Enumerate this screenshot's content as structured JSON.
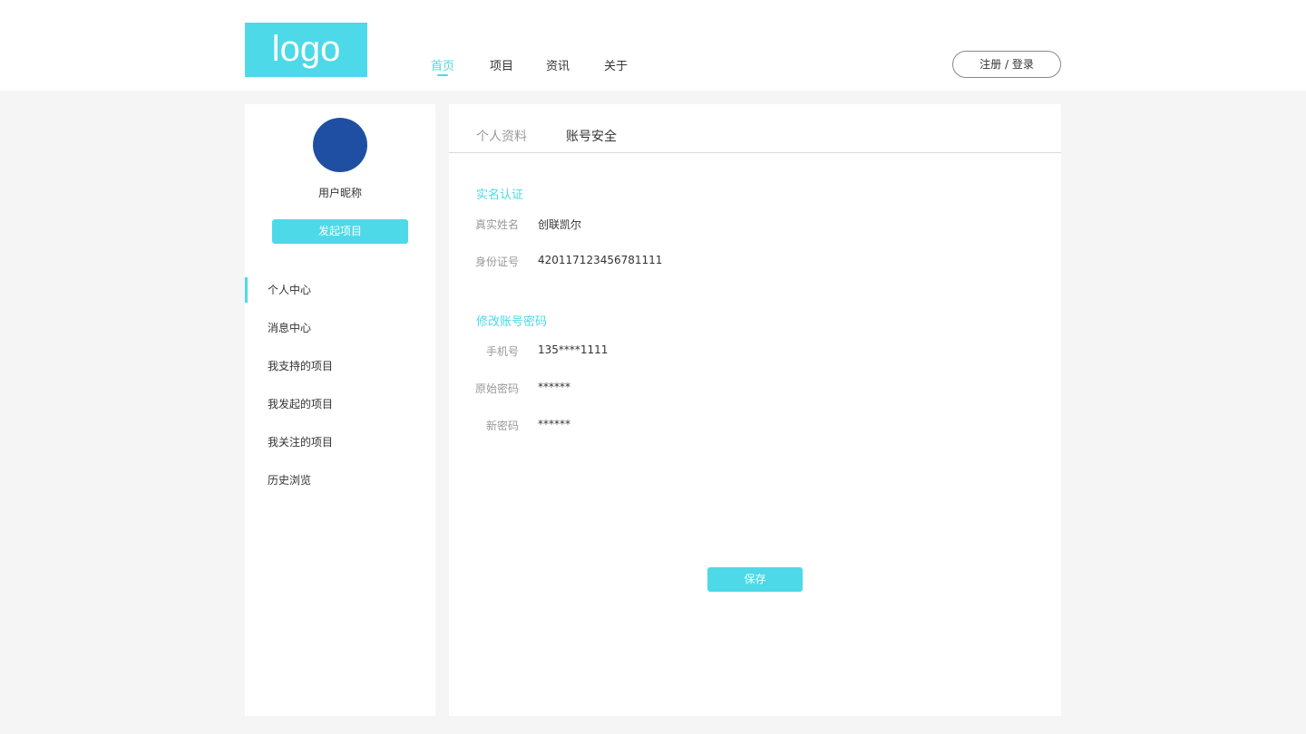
{
  "header": {
    "logo_text": "logo",
    "nav": [
      {
        "label": "首页",
        "active": true
      },
      {
        "label": "项目",
        "active": false
      },
      {
        "label": "资讯",
        "active": false
      },
      {
        "label": "关于",
        "active": false
      }
    ],
    "auth_label": "注册 / 登录"
  },
  "sidebar": {
    "nickname": "用户昵称",
    "launch_label": "发起项目",
    "menu": [
      {
        "label": "个人中心",
        "active": true
      },
      {
        "label": "消息中心",
        "active": false
      },
      {
        "label": "我支持的项目",
        "active": false
      },
      {
        "label": "我发起的项目",
        "active": false
      },
      {
        "label": "我关注的项目",
        "active": false
      },
      {
        "label": "历史浏览",
        "active": false
      }
    ]
  },
  "main": {
    "tabs": [
      {
        "label": "个人资料",
        "active": false
      },
      {
        "label": "账号安全",
        "active": true
      }
    ],
    "verification": {
      "title": "实名认证",
      "real_name_label": "真实姓名",
      "real_name_value": "创联凯尔",
      "id_label": "身份证号",
      "id_value": "420117123456781111"
    },
    "password": {
      "title": "修改账号密码",
      "phone_label": "手机号",
      "phone_value": "135****1111",
      "old_label": "原始密码",
      "old_value": "******",
      "new_label": "新密码",
      "new_value": "******"
    },
    "save_label": "保存"
  },
  "colors": {
    "accent": "#4dd9e8",
    "avatar": "#1f4fa3",
    "background": "#f5f5f5"
  }
}
